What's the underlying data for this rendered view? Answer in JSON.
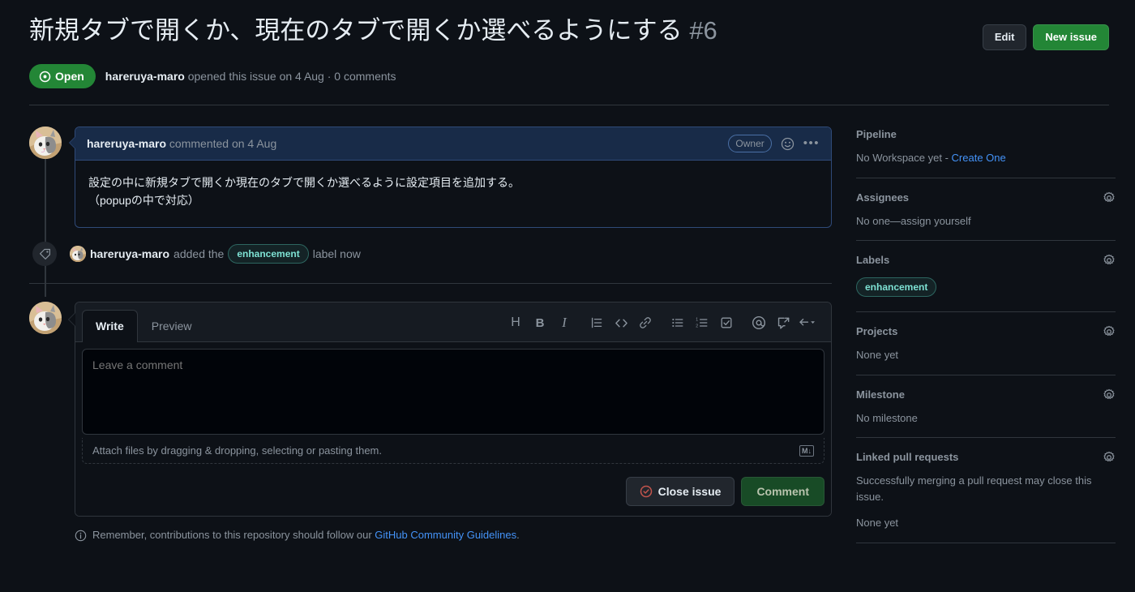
{
  "header": {
    "title": "新規タブで開くか、現在のタブで開くか選べるようにする",
    "number": "#6",
    "edit_label": "Edit",
    "new_issue_label": "New issue",
    "state": "Open",
    "meta_author": "hareruya-maro",
    "meta_rest": " opened this issue on 4 Aug · 0 comments"
  },
  "comment": {
    "author": "hareruya-maro",
    "meta": " commented on 4 Aug",
    "owner_badge": "Owner",
    "body_line1": "設定の中に新規タブで開くか現在のタブで開くか選べるように設定項目を追加する。",
    "body_line2": "（popupの中で対応）"
  },
  "event": {
    "author": "hareruya-maro",
    "added_the": " added the ",
    "label": "enhancement",
    "label_color": "#7ee2d4",
    "label_border": "#2d6660",
    "suffix": " label now"
  },
  "composer": {
    "tab_write": "Write",
    "tab_preview": "Preview",
    "placeholder": "Leave a comment",
    "value": "",
    "attach_text": "Attach files by dragging & dropping, selecting or pasting them.",
    "markdown_mark": "M↓",
    "close_label": "Close issue",
    "comment_label": "Comment",
    "toolbar": [
      {
        "name": "heading-icon",
        "glyph": "H"
      },
      {
        "name": "bold-icon",
        "glyph": "B"
      },
      {
        "name": "italic-icon",
        "glyph": "I"
      },
      {
        "name": "quote-icon",
        "glyph": ""
      },
      {
        "name": "code-icon",
        "glyph": ""
      },
      {
        "name": "link-icon",
        "glyph": ""
      },
      {
        "name": "unordered-list-icon",
        "glyph": ""
      },
      {
        "name": "ordered-list-icon",
        "glyph": ""
      },
      {
        "name": "task-list-icon",
        "glyph": ""
      },
      {
        "name": "mention-icon",
        "glyph": ""
      },
      {
        "name": "cross-reference-icon",
        "glyph": ""
      },
      {
        "name": "saved-reply-icon",
        "glyph": ""
      }
    ]
  },
  "footer": {
    "info_text": "Remember, contributions to this repository should follow our ",
    "link_text": "GitHub Community Guidelines",
    "period": "."
  },
  "sidebar": {
    "sections": [
      {
        "name": "pipeline",
        "title": "Pipeline",
        "gear": false,
        "value_prefix": "No Workspace yet - ",
        "link": "Create One",
        "value": ""
      },
      {
        "name": "assignees",
        "title": "Assignees",
        "gear": true,
        "value": "No one—assign yourself"
      },
      {
        "name": "labels",
        "title": "Labels",
        "gear": true,
        "label": "enhancement"
      },
      {
        "name": "projects",
        "title": "Projects",
        "gear": true,
        "value": "None yet"
      },
      {
        "name": "milestone",
        "title": "Milestone",
        "gear": true,
        "value": "No milestone"
      },
      {
        "name": "linked-pull-requests",
        "title": "Linked pull requests",
        "gear": true,
        "value": "Successfully merging a pull request may close this issue.",
        "value2": "None yet"
      }
    ]
  },
  "colors": {
    "accent_green": "#238636",
    "link_blue": "#4493f8",
    "label_teal": "#7ee2d4",
    "bg": "#0d1117",
    "comment_header_bg": "#182b48",
    "border": "#30363d"
  }
}
